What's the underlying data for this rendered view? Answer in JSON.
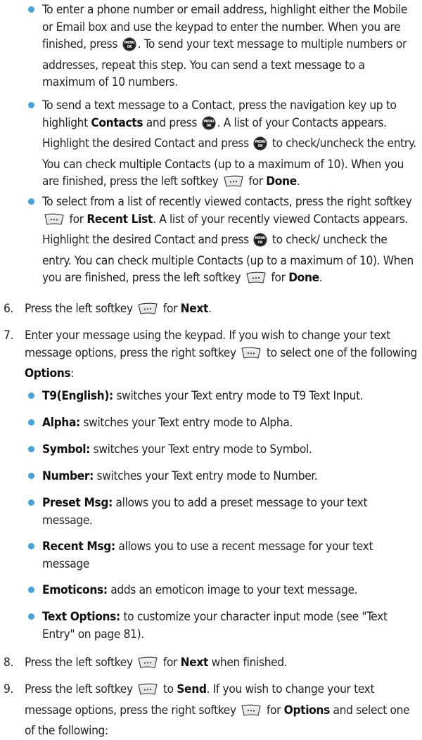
{
  "bullets_contacts": [
    {
      "a": "To enter a phone number or email address, highlight either the Mobile or Email box and use the keypad to enter the number. When you are finished, press ",
      "b": ". To send your text message to multiple numbers or addresses, repeat this step. You can send a text message to a maximum of 10 numbers."
    },
    {
      "a": "To send a text message to a Contact, press the navigation key up to highlight ",
      "b1": "Contacts",
      "c": " and press ",
      "d": ". A list of your Contacts appears. Highlight the desired Contact and press ",
      "e": " to check/uncheck the entry. You can check multiple Contacts (up to a maximum of 10). When you are finished, press the left softkey ",
      "f": " for ",
      "b2": "Done",
      "g": "."
    },
    {
      "a": "To select from a list of recently viewed contacts, press the right softkey ",
      "b": " for ",
      "b1": "Recent List",
      "c": ". A list of your recently viewed Contacts appears. Highlight the desired Contact and press ",
      "d": " to check/ uncheck the entry. You can check multiple Contacts (up to a maximum of 10). When you are finished, press the left softkey ",
      "e": " for ",
      "b2": "Done",
      "f": "."
    }
  ],
  "step6": {
    "num": "6.",
    "a": "Press the left softkey ",
    "b": " for ",
    "bold": "Next",
    "c": "."
  },
  "step7": {
    "num": "7.",
    "a": "Enter your message using the keypad. If you wish to change your text message options, press the right softkey ",
    "b": " to select one of the following ",
    "bold": "Options",
    "c": ":"
  },
  "options": [
    {
      "label": "T9(English):",
      "text": " switches your Text entry mode to T9 Text Input."
    },
    {
      "label": "Alpha:",
      "text": " switches your Text entry mode to Alpha."
    },
    {
      "label": "Symbol:",
      "text": " switches your Text entry mode to Symbol."
    },
    {
      "label": "Number:",
      "text": " switches your Text entry mode to Number."
    },
    {
      "label": "Preset Msg:",
      "text": " allows you to add a preset message to your text message."
    },
    {
      "label": "Recent Msg:",
      "text": " allows you to use a recent message for your text message"
    },
    {
      "label": "Emoticons:",
      "text": " adds an emoticon image to your text message."
    },
    {
      "label": "Text Options:",
      "text": " to customize your character input mode (see \"Text Entry\" on page 81)."
    }
  ],
  "step8": {
    "num": "8.",
    "a": "Press the left softkey ",
    "b": " for ",
    "bold": "Next",
    "c": " when finished."
  },
  "step9": {
    "num": "9.",
    "a": "Press the left softkey ",
    "b": " to ",
    "bold1": "Send",
    "c": ". If you wish to change your text message options, press the right softkey ",
    "d": " for ",
    "bold2": "Options",
    "e": " and select one of the following:"
  },
  "icons": {
    "ok_key": "menu-ok-key-icon",
    "left_softkey": "left-softkey-icon",
    "right_softkey": "right-softkey-icon",
    "ok_key_text_top": "MENU",
    "ok_key_text_bottom": "OK",
    "bullet_color": "#3fa4df"
  }
}
